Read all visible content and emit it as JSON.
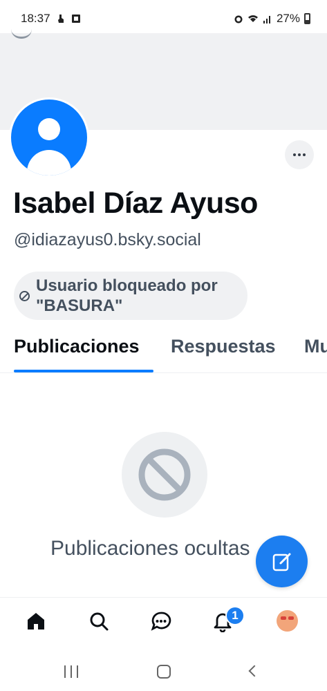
{
  "status_bar": {
    "time": "18:37",
    "battery": "27%",
    "icons": [
      "notification-icon",
      "sim-icon",
      "alarm-icon",
      "wifi-icon",
      "signal-icon",
      "battery-icon"
    ]
  },
  "profile": {
    "display_name": "Isabel Díaz Ayuso",
    "handle": "@idiazayus0.bsky.social",
    "blocked_label": "Usuario bloqueado por \"BASURA\"",
    "more_icon": "ellipsis-icon",
    "avatar_color": "#0a7cff"
  },
  "tabs": [
    {
      "label": "Publicaciones",
      "active": true
    },
    {
      "label": "Respuestas",
      "active": false
    },
    {
      "label": "Multimedia",
      "active": false
    }
  ],
  "content": {
    "hidden_message": "Publicaciones ocultas",
    "hidden_icon": "prohibited-icon"
  },
  "fab": {
    "icon": "compose-icon"
  },
  "bottom_nav": {
    "items": [
      "home-icon",
      "search-icon",
      "chat-icon",
      "notifications-icon",
      "profile-avatar"
    ],
    "notification_count": "1"
  },
  "colors": {
    "accent": "#1c7ef0",
    "muted_text": "#44505e",
    "surface": "#f0f1f3"
  }
}
